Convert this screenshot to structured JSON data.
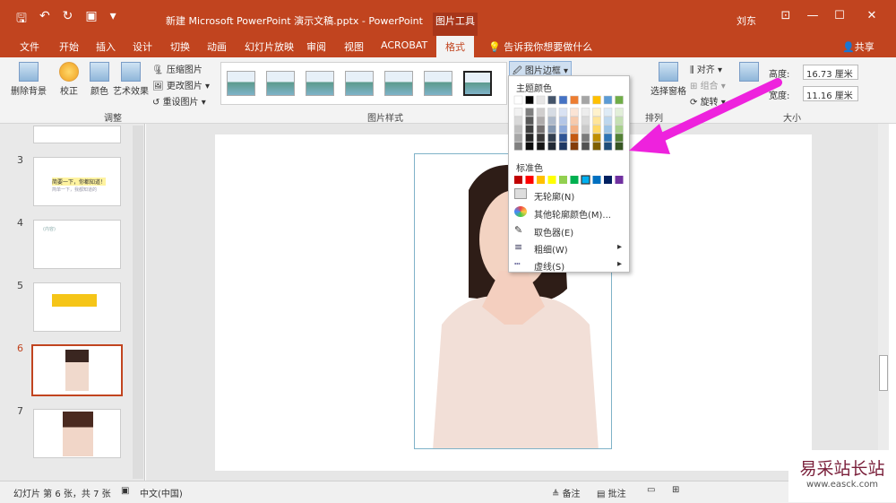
{
  "titlebar": {
    "title": "新建 Microsoft PowerPoint 演示文稿.pptx  -  PowerPoint",
    "context": "图片工具",
    "user": "刘东"
  },
  "tabs": [
    "文件",
    "开始",
    "插入",
    "设计",
    "切换",
    "动画",
    "幻灯片放映",
    "审阅",
    "视图",
    "ACROBAT",
    "格式"
  ],
  "tellme": "告诉我你想要做什么",
  "share": "共享",
  "ribbon": {
    "remove_bg": "删除背景",
    "correct": "校正",
    "color": "颜色",
    "art": "艺术效果",
    "compress": "压缩图片",
    "change": "更改图片",
    "reset": "重设图片",
    "group_adjust": "调整",
    "group_styles": "图片样式",
    "group_arrange": "排列",
    "group_size": "大小",
    "border_btn": "图片边框",
    "align": "对齐",
    "combine": "组合",
    "rotate": "旋转",
    "selection": "选择窗格",
    "height_label": "高度:",
    "height_val": "16.73 厘米",
    "width_label": "宽度:",
    "width_val": "11.16 厘米"
  },
  "slides": {
    "n3": "3",
    "n4": "4",
    "n5": "5",
    "n6": "6",
    "n7": "7",
    "s3_text": "简要一下，你都知道！",
    "s3_sub": "简单一下，我都知道的",
    "s4_text": "(内容)"
  },
  "dropdown": {
    "theme_label": "主题颜色",
    "standard_label": "标准色",
    "no_outline": "无轮廓(N)",
    "more_colors": "其他轮廓颜色(M)...",
    "eyedropper": "取色器(E)",
    "weight": "粗细(W)",
    "dashes": "虚线(S)"
  },
  "status": {
    "slide_info": "幻灯片 第 6 张，共 7 张",
    "lang": "中文(中国)",
    "notes": "备注",
    "comments": "批注"
  },
  "watermark": {
    "brand": "易采站长站",
    "url": "www.easck.com"
  },
  "colors": {
    "brand": "#c1441f",
    "arrow": "#ee22dd"
  }
}
